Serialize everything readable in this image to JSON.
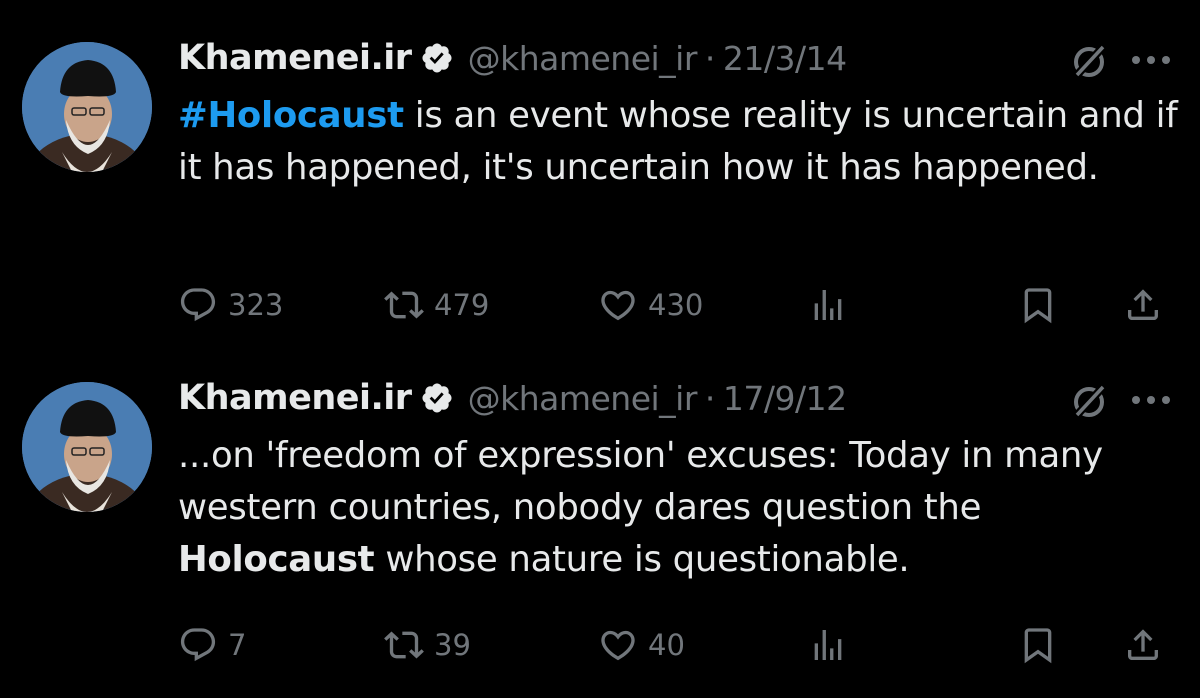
{
  "colors": {
    "background": "#000000",
    "text": "#e7e9ea",
    "muted": "#71767b",
    "link": "#1d9bf0",
    "verified": "#e7e9ea"
  },
  "tweets": [
    {
      "display_name": "Khamenei.ir",
      "handle": "@khamenei_ir",
      "separator": "·",
      "date": "21/3/14",
      "text_segments": [
        {
          "text": "#Holocaust",
          "style": "hashtag"
        },
        {
          "text": " is an event whose reality is uncertain and if it has happened, it's uncertain how it has happened.",
          "style": "normal"
        }
      ],
      "replies": "323",
      "retweets": "479",
      "likes": "430"
    },
    {
      "display_name": "Khamenei.ir",
      "handle": "@khamenei_ir",
      "separator": "·",
      "date": "17/9/12",
      "text_segments": [
        {
          "text": "...on 'freedom of expression' excuses: Today in many western countries, nobody dares question the ",
          "style": "normal"
        },
        {
          "text": "Holocaust",
          "style": "bold"
        },
        {
          "text": " whose nature is questionable.",
          "style": "normal"
        }
      ],
      "replies": "7",
      "retweets": "39",
      "likes": "40"
    }
  ],
  "icons": {
    "verified": "verified-badge-icon",
    "grok": "grok-icon",
    "more": "more-dots-icon",
    "reply": "reply-icon",
    "retweet": "retweet-icon",
    "like": "heart-icon",
    "views": "views-icon",
    "bookmark": "bookmark-icon",
    "share": "share-icon"
  }
}
